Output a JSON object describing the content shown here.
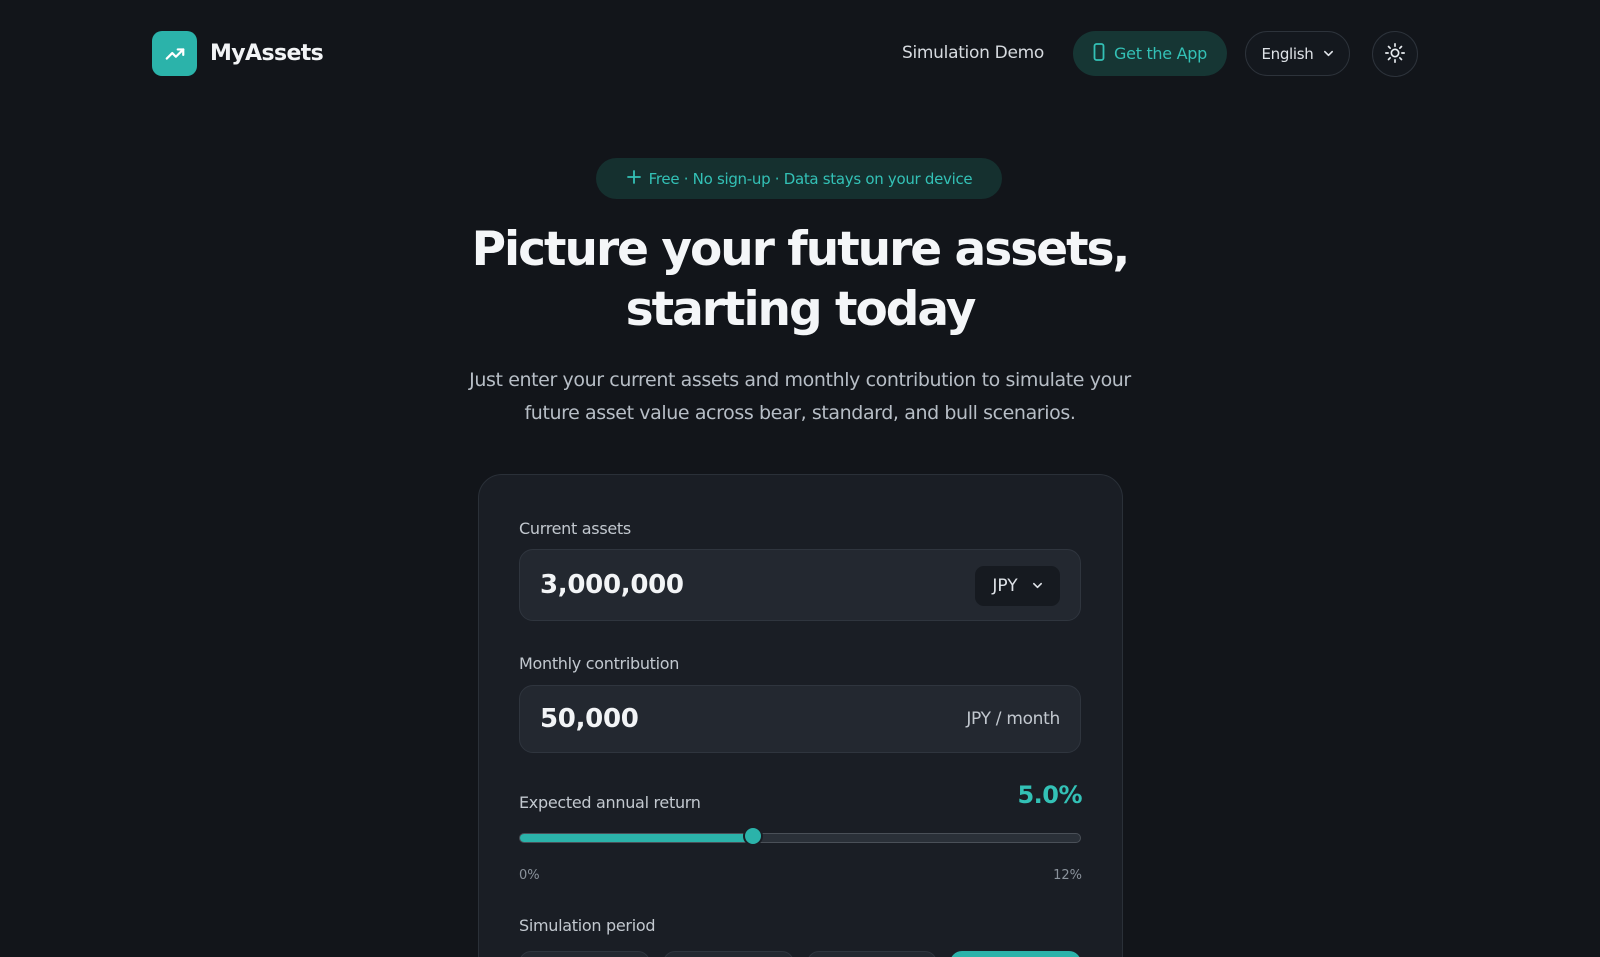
{
  "header": {
    "brand": "MyAssets",
    "logo_icon": "trend-up-icon",
    "nav_demo": "Simulation Demo",
    "get_app_label": "Get the App",
    "get_app_icon": "phone-icon",
    "language": "English",
    "theme_icon": "sun-icon"
  },
  "hero": {
    "badge": "Free · No sign-up · Data stays on your device",
    "badge_icon": "plus-icon",
    "title_line1": "Picture your future assets,",
    "title_line2": "starting today",
    "subtitle_line1": "Just enter your current assets and monthly contribution to simulate your",
    "subtitle_line2": "future asset value across bear, standard, and bull scenarios."
  },
  "form": {
    "current_assets_label": "Current assets",
    "current_assets_value": "3,000,000",
    "currency": "JPY",
    "monthly_label": "Monthly contribution",
    "monthly_value": "50,000",
    "monthly_unit": "JPY / month",
    "return_label": "Expected annual return",
    "return_value": "5.0%",
    "return_fraction": 0.4167,
    "range_min": "0%",
    "range_max": "12%",
    "period_label": "Simulation period",
    "period_options": [
      "",
      "",
      "",
      ""
    ],
    "period_active_index": 3
  },
  "colors": {
    "accent": "#2bb3aa",
    "background": "#12151a",
    "card": "#1a1e25"
  }
}
